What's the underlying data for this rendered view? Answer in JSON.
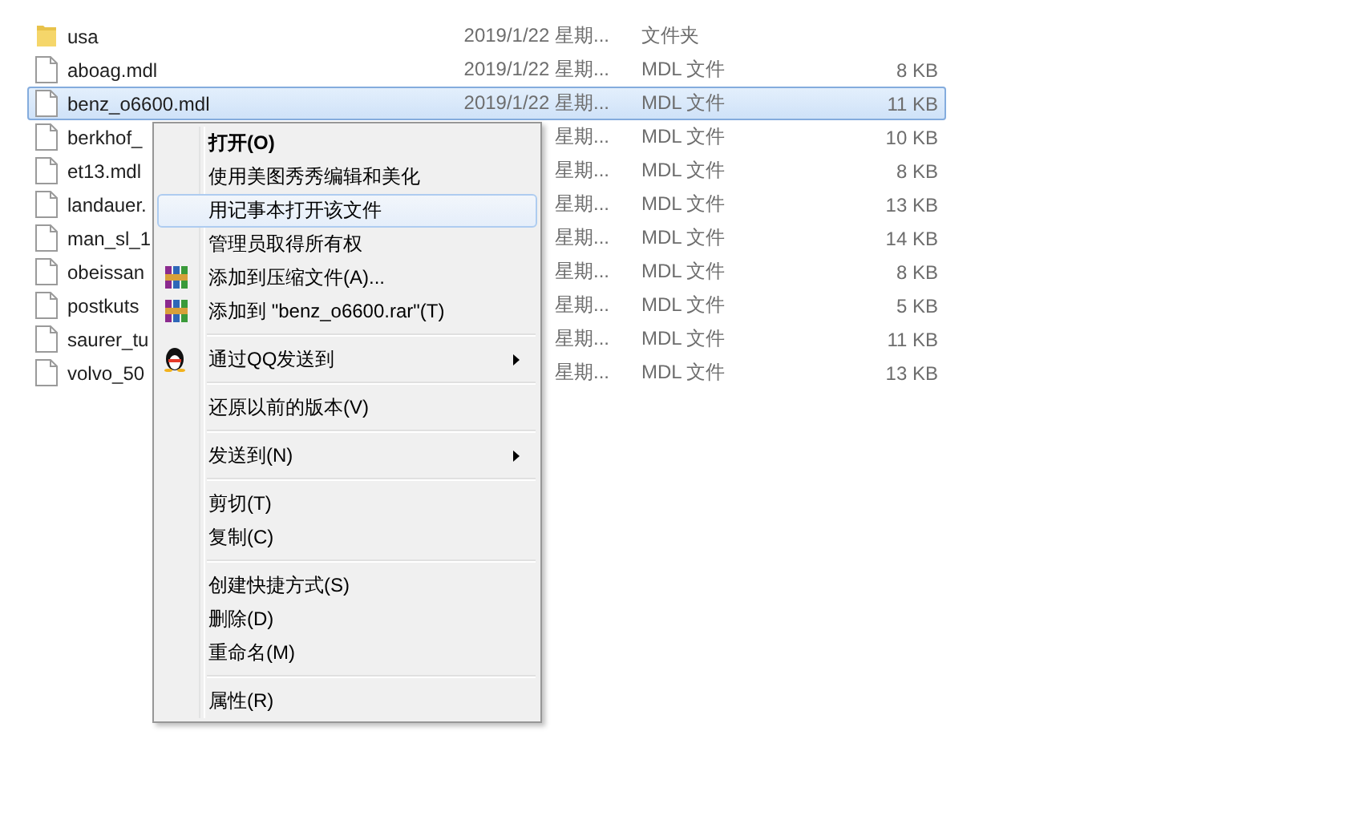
{
  "files": [
    {
      "kind": "folder",
      "name": "usa",
      "date": "2019/1/22 星期...",
      "type": "文件夹",
      "selected": false
    },
    {
      "kind": "file",
      "name": "aboag.mdl",
      "date": "2019/1/22 星期...",
      "type": "MDL 文件",
      "size": "8 KB",
      "selected": false
    },
    {
      "kind": "file",
      "name": "benz_o6600.mdl",
      "date": "2019/1/22 星期...",
      "type": "MDL 文件",
      "size": "11 KB",
      "selected": true
    },
    {
      "kind": "file",
      "name": "berkhof_",
      "date": "星期...",
      "type": "MDL 文件",
      "size": "10 KB",
      "selected": false
    },
    {
      "kind": "file",
      "name": "et13.mdl",
      "date": "星期...",
      "type": "MDL 文件",
      "size": "8 KB",
      "selected": false
    },
    {
      "kind": "file",
      "name": "landauer.",
      "date": "星期...",
      "type": "MDL 文件",
      "size": "13 KB",
      "selected": false
    },
    {
      "kind": "file",
      "name": "man_sl_1",
      "date": "星期...",
      "type": "MDL 文件",
      "size": "14 KB",
      "selected": false
    },
    {
      "kind": "file",
      "name": "obeissan",
      "date": "星期...",
      "type": "MDL 文件",
      "size": "8 KB",
      "selected": false
    },
    {
      "kind": "file",
      "name": "postkuts",
      "date": "星期...",
      "type": "MDL 文件",
      "size": "5 KB",
      "selected": false
    },
    {
      "kind": "file",
      "name": "saurer_tu",
      "date": "星期...",
      "type": "MDL 文件",
      "size": "11 KB",
      "selected": false
    },
    {
      "kind": "file",
      "name": "volvo_50",
      "date": "星期...",
      "type": "MDL 文件",
      "size": "13 KB",
      "selected": false
    }
  ],
  "context_menu": [
    {
      "kind": "item",
      "label": "打开(O)",
      "bold": true,
      "selected": false
    },
    {
      "kind": "item",
      "label": "使用美图秀秀编辑和美化",
      "selected": false
    },
    {
      "kind": "item",
      "label": "用记事本打开该文件",
      "selected": true
    },
    {
      "kind": "item",
      "label": "管理员取得所有权",
      "selected": false
    },
    {
      "kind": "archive_item",
      "label": "添加到压缩文件(A)...",
      "selected": false
    },
    {
      "kind": "archive_item",
      "label": "添加到 \"benz_o6600.rar\"(T)",
      "selected": false
    },
    {
      "kind": "separator"
    },
    {
      "kind": "share_item",
      "label": "通过QQ发送到",
      "submenu": true,
      "selected": false
    },
    {
      "kind": "separator"
    },
    {
      "kind": "item",
      "label": "还原以前的版本(V)",
      "selected": false
    },
    {
      "kind": "separator"
    },
    {
      "kind": "item",
      "label": "发送到(N)",
      "submenu": true,
      "selected": false
    },
    {
      "kind": "separator"
    },
    {
      "kind": "item",
      "label": "剪切(T)",
      "selected": false
    },
    {
      "kind": "item",
      "label": "复制(C)",
      "selected": false
    },
    {
      "kind": "separator"
    },
    {
      "kind": "item",
      "label": "创建快捷方式(S)",
      "selected": false
    },
    {
      "kind": "item",
      "label": "删除(D)",
      "selected": false
    },
    {
      "kind": "item",
      "label": "重命名(M)",
      "selected": false
    },
    {
      "kind": "separator"
    },
    {
      "kind": "item",
      "label": "属性(R)",
      "selected": false
    }
  ]
}
